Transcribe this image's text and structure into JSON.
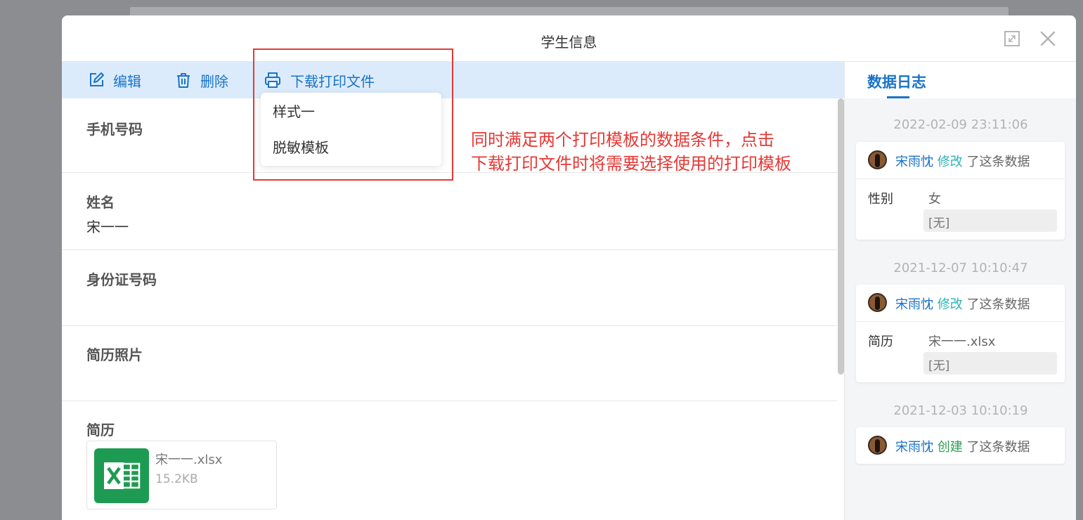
{
  "dialog": {
    "title": "学生信息"
  },
  "toolbar": {
    "edit_label": "编辑",
    "delete_label": "删除",
    "print_label": "下载打印文件"
  },
  "print_menu": {
    "options": [
      "样式一",
      "脱敏模板"
    ]
  },
  "annotation": {
    "line1": "同时满足两个打印模板的数据条件，点击",
    "line2": "下载打印文件时将需要选择使用的打印模板"
  },
  "fields": {
    "phone_label": "手机号码",
    "name_label": "姓名",
    "name_value": "宋一一",
    "id_label": "身份证号码",
    "photo_label": "简历照片",
    "resume_label": "简历",
    "resume_file": {
      "name": "宋一一.xlsx",
      "size": "15.2KB"
    }
  },
  "log_panel": {
    "tab_label": "数据日志",
    "entries": [
      {
        "time": "2022-02-09 23:11:06",
        "user": "宋雨忱",
        "action": "修改",
        "rest": "了这条数据",
        "field": "性别",
        "new_value": "女",
        "old_value": "[无]"
      },
      {
        "time": "2021-12-07 10:10:47",
        "user": "宋雨忱",
        "action": "修改",
        "rest": "了这条数据",
        "field": "简历",
        "new_value": "宋一一.xlsx",
        "old_value": "[无]"
      },
      {
        "time": "2021-12-03 10:10:19",
        "user": "宋雨忱",
        "action": "创建",
        "rest": "了这条数据"
      }
    ]
  },
  "colors": {
    "accent": "#1a73c9",
    "toolbar_bg": "#dcebfb",
    "annotation": "#e53935",
    "modify": "#2bb3b3",
    "create": "#2e9e55"
  }
}
